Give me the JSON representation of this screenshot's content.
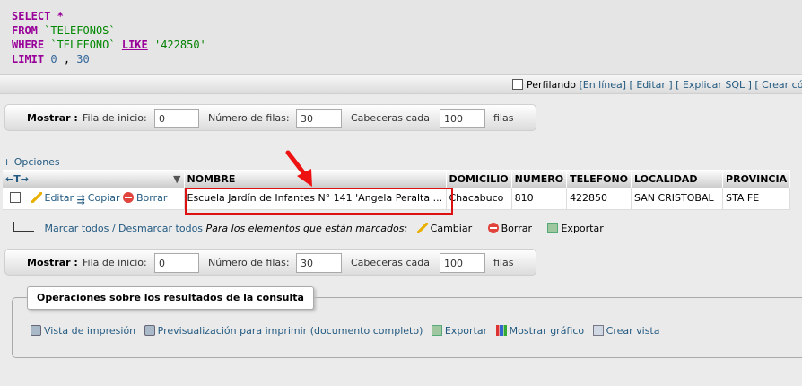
{
  "sql": {
    "select": "SELECT",
    "star": "*",
    "from": "FROM",
    "table": "`TELEFONOS`",
    "where": "WHERE",
    "column": "`TELEFONO`",
    "like": "LIKE",
    "value": "'422850'",
    "limit": "LIMIT",
    "limit_start": "0",
    "limit_sep": ",",
    "limit_count": "30"
  },
  "sql_tools": {
    "profiling_label": "Perfilando",
    "links_text": "[En línea] [ Editar ] [ Explicar SQL ] [ Crear códi"
  },
  "nav": {
    "show_label": "Mostrar :",
    "start_label": "Fila de inicio:",
    "start_value": "0",
    "rows_label": "Número de filas:",
    "rows_value": "30",
    "headers_label": "Cabeceras cada",
    "headers_value": "100",
    "rows_suffix": "filas"
  },
  "options_link": "+ Opciones",
  "table": {
    "col_headers": [
      "NOMBRE",
      "DOMICILIO",
      "NUMERO",
      "TELEFONO",
      "LOCALIDAD",
      "PROVINCIA"
    ],
    "actions": {
      "edit": "Editar",
      "copy": "Copiar",
      "delete": "Borrar"
    },
    "row": {
      "nombre": "Escuela Jardín de Infantes N° 141 'Angela Peralta ...",
      "domicilio": "Chacabuco",
      "numero": "810",
      "telefono": "422850",
      "localidad": "SAN CRISTOBAL",
      "provincia": "STA FE"
    }
  },
  "selection": {
    "mark_all": "Marcar todos",
    "separator": "/",
    "unmark_all": "Desmarcar todos",
    "for_marked": "Para los elementos que están marcados:",
    "change": "Cambiar",
    "delete": "Borrar",
    "export": "Exportar"
  },
  "operations": {
    "legend": "Operaciones sobre los resultados de la consulta",
    "print_view": "Vista de impresión",
    "print_full": "Previsualización para imprimir (documento completo)",
    "export": "Exportar",
    "chart": "Mostrar gráfico",
    "create_view": "Crear vista"
  },
  "colors": {
    "link": "#235a81",
    "keyword": "#990099",
    "annotation": "#dd1111"
  }
}
